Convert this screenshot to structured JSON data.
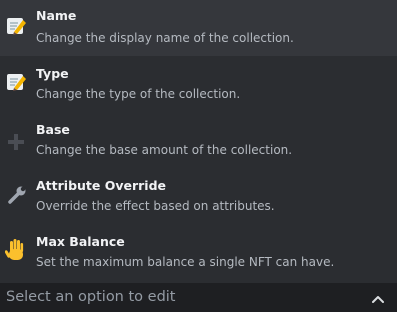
{
  "options": [
    {
      "label": "Name",
      "description": "Change the display name of the collection.",
      "icon": "memo-pencil-icon"
    },
    {
      "label": "Type",
      "description": "Change the type of the collection.",
      "icon": "memo-pencil-icon"
    },
    {
      "label": "Base",
      "description": "Change the base amount of the collection.",
      "icon": "plus-icon"
    },
    {
      "label": "Attribute Override",
      "description": "Override the effect based on attributes.",
      "icon": "wrench-icon"
    },
    {
      "label": "Max Balance",
      "description": "Set the maximum balance a single NFT can have.",
      "icon": "raised-hand-icon"
    }
  ],
  "select": {
    "placeholder": "Select an option to edit",
    "icon": "chevron-up-icon"
  }
}
